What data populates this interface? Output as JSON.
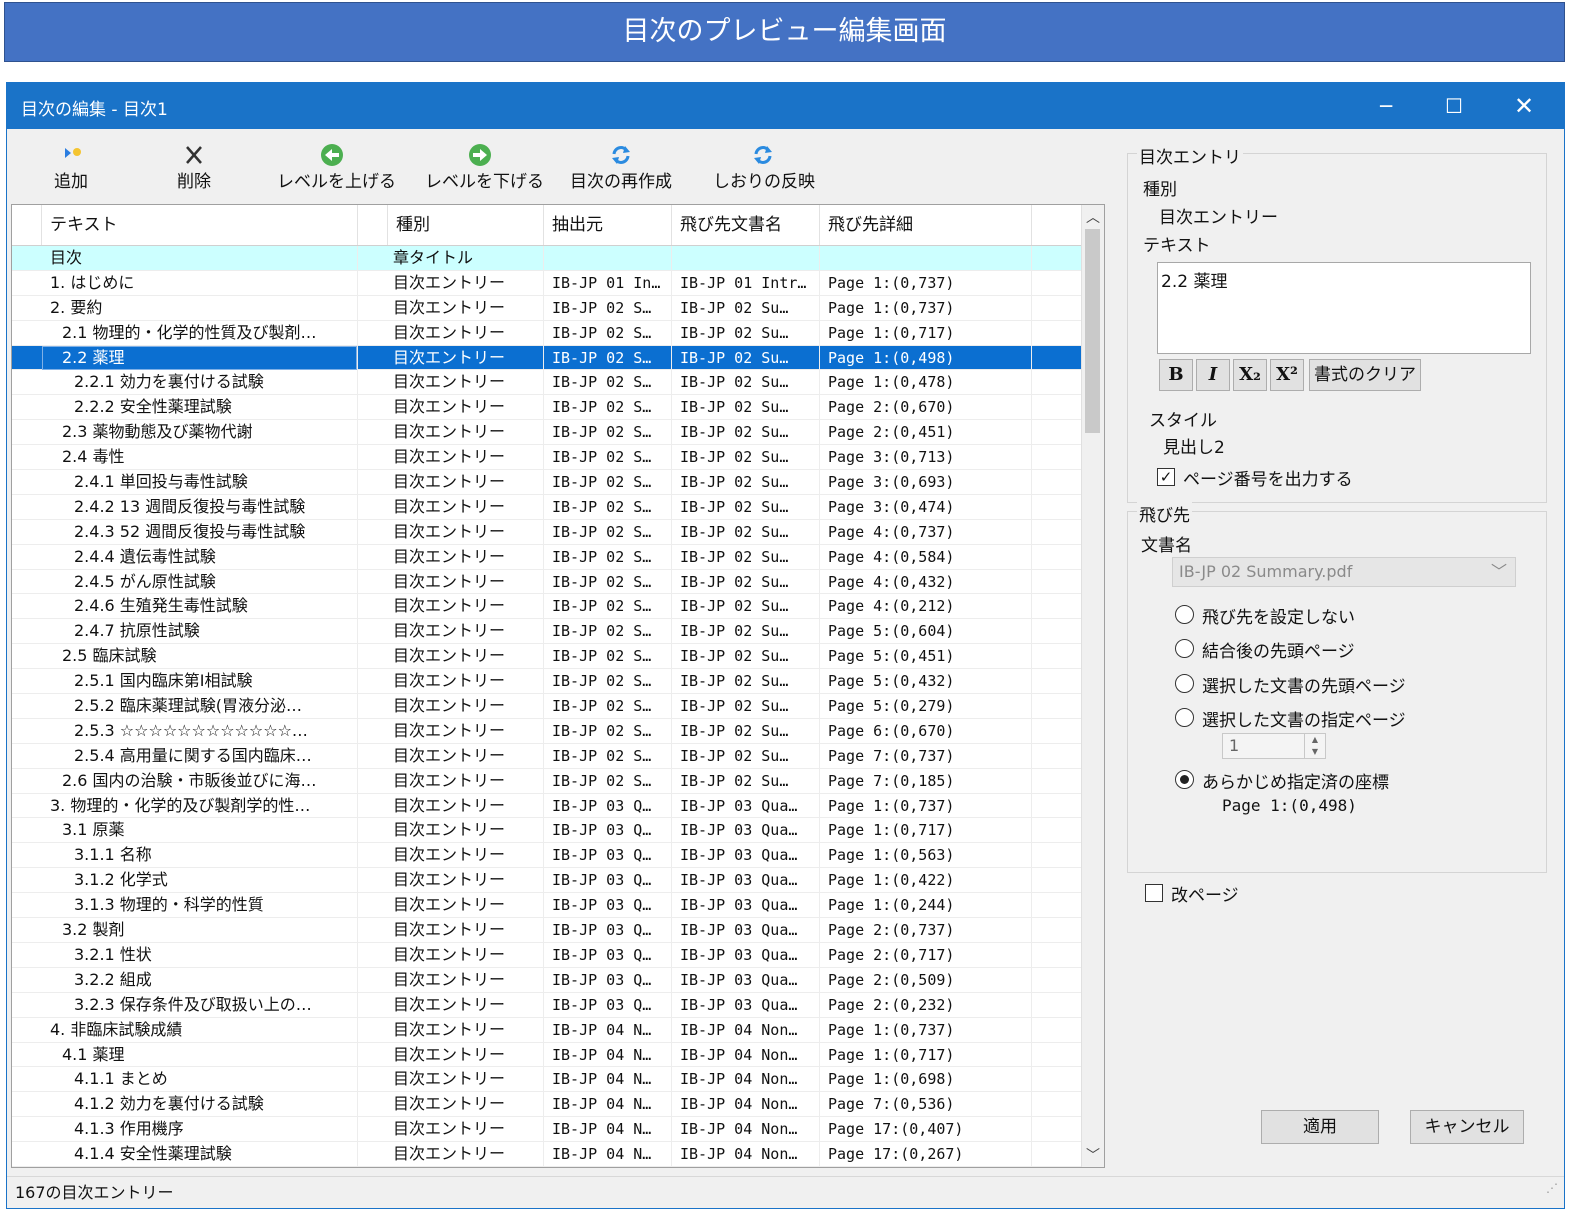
{
  "banner": {
    "title": "目次のプレビュー編集画面"
  },
  "window": {
    "title": "目次の編集 - 目次1",
    "minimize": "─",
    "maximize": "☐",
    "close": "✕"
  },
  "toolbar": {
    "add": "追加",
    "delete": "削除",
    "level_up": "レベルを上げる",
    "level_down": "レベルを下げる",
    "regenerate": "目次の再作成",
    "bookmarks": "しおりの反映"
  },
  "table": {
    "columns": [
      "テキスト",
      "種別",
      "抽出元",
      "飛び先文書名",
      "飛び先詳細"
    ],
    "rows": [
      {
        "text": "目次",
        "kind": "章タイトル",
        "src": "",
        "doc": "",
        "detail": ""
      },
      {
        "text": "1. はじめに",
        "kind": "目次エントリー",
        "src": "IB-JP 01 In…",
        "doc": "IB-JP 01 Intr…",
        "detail": "Page 1:(0,737)"
      },
      {
        "text": "2. 要約",
        "kind": "目次エントリー",
        "src": "IB-JP 02 S…",
        "doc": "IB-JP 02 Su…",
        "detail": "Page 1:(0,737)"
      },
      {
        "text": "2.1 物理的・化学的性質及び製剤…",
        "kind": "目次エントリー",
        "src": "IB-JP 02 S…",
        "doc": "IB-JP 02 Su…",
        "detail": "Page 1:(0,717)"
      },
      {
        "text": "2.2 薬理",
        "kind": "目次エントリー",
        "src": "IB-JP 02 S…",
        "doc": "IB-JP 02 Su…",
        "detail": "Page 1:(0,498)"
      },
      {
        "text": "2.2.1 効力を裏付ける試験",
        "kind": "目次エントリー",
        "src": "IB-JP 02 S…",
        "doc": "IB-JP 02 Su…",
        "detail": "Page 1:(0,478)"
      },
      {
        "text": "2.2.2 安全性薬理試験",
        "kind": "目次エントリー",
        "src": "IB-JP 02 S…",
        "doc": "IB-JP 02 Su…",
        "detail": "Page 2:(0,670)"
      },
      {
        "text": "2.3 薬物動態及び薬物代謝",
        "kind": "目次エントリー",
        "src": "IB-JP 02 S…",
        "doc": "IB-JP 02 Su…",
        "detail": "Page 2:(0,451)"
      },
      {
        "text": "2.4 毒性",
        "kind": "目次エントリー",
        "src": "IB-JP 02 S…",
        "doc": "IB-JP 02 Su…",
        "detail": "Page 3:(0,713)"
      },
      {
        "text": "2.4.1 単回投与毒性試験",
        "kind": "目次エントリー",
        "src": "IB-JP 02 S…",
        "doc": "IB-JP 02 Su…",
        "detail": "Page 3:(0,693)"
      },
      {
        "text": "2.4.2 13 週間反復投与毒性試験",
        "kind": "目次エントリー",
        "src": "IB-JP 02 S…",
        "doc": "IB-JP 02 Su…",
        "detail": "Page 3:(0,474)"
      },
      {
        "text": "2.4.3 52 週間反復投与毒性試験",
        "kind": "目次エントリー",
        "src": "IB-JP 02 S…",
        "doc": "IB-JP 02 Su…",
        "detail": "Page 4:(0,737)"
      },
      {
        "text": "2.4.4 遺伝毒性試験",
        "kind": "目次エントリー",
        "src": "IB-JP 02 S…",
        "doc": "IB-JP 02 Su…",
        "detail": "Page 4:(0,584)"
      },
      {
        "text": "2.4.5 がん原性試験",
        "kind": "目次エントリー",
        "src": "IB-JP 02 S…",
        "doc": "IB-JP 02 Su…",
        "detail": "Page 4:(0,432)"
      },
      {
        "text": "2.4.6 生殖発生毒性試験",
        "kind": "目次エントリー",
        "src": "IB-JP 02 S…",
        "doc": "IB-JP 02 Su…",
        "detail": "Page 4:(0,212)"
      },
      {
        "text": "2.4.7 抗原性試験",
        "kind": "目次エントリー",
        "src": "IB-JP 02 S…",
        "doc": "IB-JP 02 Su…",
        "detail": "Page 5:(0,604)"
      },
      {
        "text": "2.5 臨床試験",
        "kind": "目次エントリー",
        "src": "IB-JP 02 S…",
        "doc": "IB-JP 02 Su…",
        "detail": "Page 5:(0,451)"
      },
      {
        "text": "2.5.1 国内臨床第Ⅰ相試験",
        "kind": "目次エントリー",
        "src": "IB-JP 02 S…",
        "doc": "IB-JP 02 Su…",
        "detail": "Page 5:(0,432)"
      },
      {
        "text": "2.5.2 臨床薬理試験(胃液分泌…",
        "kind": "目次エントリー",
        "src": "IB-JP 02 S…",
        "doc": "IB-JP 02 Su…",
        "detail": "Page 5:(0,279)"
      },
      {
        "text": "2.5.3 ☆☆☆☆☆☆☆☆☆☆☆☆…",
        "kind": "目次エントリー",
        "src": "IB-JP 02 S…",
        "doc": "IB-JP 02 Su…",
        "detail": "Page 6:(0,670)"
      },
      {
        "text": "2.5.4 高用量に関する国内臨床…",
        "kind": "目次エントリー",
        "src": "IB-JP 02 S…",
        "doc": "IB-JP 02 Su…",
        "detail": "Page 7:(0,737)"
      },
      {
        "text": "2.6 国内の治験・市販後並びに海…",
        "kind": "目次エントリー",
        "src": "IB-JP 02 S…",
        "doc": "IB-JP 02 Su…",
        "detail": "Page 7:(0,185)"
      },
      {
        "text": "3. 物理的・化学的及び製剤学的性…",
        "kind": "目次エントリー",
        "src": "IB-JP 03 Q…",
        "doc": "IB-JP 03 Qua…",
        "detail": "Page 1:(0,737)"
      },
      {
        "text": "3.1 原薬",
        "kind": "目次エントリー",
        "src": "IB-JP 03 Q…",
        "doc": "IB-JP 03 Qua…",
        "detail": "Page 1:(0,717)"
      },
      {
        "text": "3.1.1 名称",
        "kind": "目次エントリー",
        "src": "IB-JP 03 Q…",
        "doc": "IB-JP 03 Qua…",
        "detail": "Page 1:(0,563)"
      },
      {
        "text": "3.1.2 化学式",
        "kind": "目次エントリー",
        "src": "IB-JP 03 Q…",
        "doc": "IB-JP 03 Qua…",
        "detail": "Page 1:(0,422)"
      },
      {
        "text": "3.1.3 物理的・科学的性質",
        "kind": "目次エントリー",
        "src": "IB-JP 03 Q…",
        "doc": "IB-JP 03 Qua…",
        "detail": "Page 1:(0,244)"
      },
      {
        "text": "3.2 製剤",
        "kind": "目次エントリー",
        "src": "IB-JP 03 Q…",
        "doc": "IB-JP 03 Qua…",
        "detail": "Page 2:(0,737)"
      },
      {
        "text": "3.2.1 性状",
        "kind": "目次エントリー",
        "src": "IB-JP 03 Q…",
        "doc": "IB-JP 03 Qua…",
        "detail": "Page 2:(0,717)"
      },
      {
        "text": "3.2.2 組成",
        "kind": "目次エントリー",
        "src": "IB-JP 03 Q…",
        "doc": "IB-JP 03 Qua…",
        "detail": "Page 2:(0,509)"
      },
      {
        "text": "3.2.3 保存条件及び取扱い上の…",
        "kind": "目次エントリー",
        "src": "IB-JP 03 Q…",
        "doc": "IB-JP 03 Qua…",
        "detail": "Page 2:(0,232)"
      },
      {
        "text": "4. 非臨床試験成績",
        "kind": "目次エントリー",
        "src": "IB-JP 04 N…",
        "doc": "IB-JP 04 Non…",
        "detail": "Page 1:(0,737)"
      },
      {
        "text": "4.1 薬理",
        "kind": "目次エントリー",
        "src": "IB-JP 04 N…",
        "doc": "IB-JP 04 Non…",
        "detail": "Page 1:(0,717)"
      },
      {
        "text": "4.1.1 まとめ",
        "kind": "目次エントリー",
        "src": "IB-JP 04 N…",
        "doc": "IB-JP 04 Non…",
        "detail": "Page 1:(0,698)"
      },
      {
        "text": "4.1.2 効力を裏付ける試験",
        "kind": "目次エントリー",
        "src": "IB-JP 04 N…",
        "doc": "IB-JP 04 Non…",
        "detail": "Page 7:(0,536)"
      },
      {
        "text": "4.1.3 作用機序",
        "kind": "目次エントリー",
        "src": "IB-JP 04 N…",
        "doc": "IB-JP 04 Non…",
        "detail": "Page 17:(0,407)"
      },
      {
        "text": "4.1.4 安全性薬理試験",
        "kind": "目次エントリー",
        "src": "IB-JP 04 N…",
        "doc": "IB-JP 04 Non…",
        "detail": "Page 17:(0,267)"
      }
    ]
  },
  "status": {
    "count_text": "167の目次エントリー"
  },
  "panel": {
    "entry_group": "目次エントリ",
    "kind_label": "種別",
    "kind_value": "目次エントリー",
    "text_label": "テキスト",
    "text_value": "2.2 薬理",
    "fmt_bold": "B",
    "fmt_italic": "I",
    "fmt_sub": "X₂",
    "fmt_sup": "X²",
    "fmt_clear": "書式のクリア",
    "style_label": "スタイル",
    "style_value": "見出し2",
    "output_page_label": "ページ番号を出力する",
    "dest_group": "飛び先",
    "docname_label": "文書名",
    "docname_value": "IB-JP 02 Summary.pdf",
    "opt_none": "飛び先を設定しない",
    "opt_first_merged": "結合後の先頭ページ",
    "opt_first_selected": "選択した文書の先頭ページ",
    "opt_specified": "選択した文書の指定ページ",
    "spin_value": "1",
    "opt_preset": "あらかじめ指定済の座標",
    "preset_value": "Page 1:(0,498)",
    "pagebreak_label": "改ページ",
    "apply": "適用",
    "cancel": "キャンセル"
  },
  "colors": {
    "accent": "#1a73c8",
    "banner": "#4472c4",
    "selected_row": "#0b6fd1",
    "tint_row": "#ccffff"
  }
}
